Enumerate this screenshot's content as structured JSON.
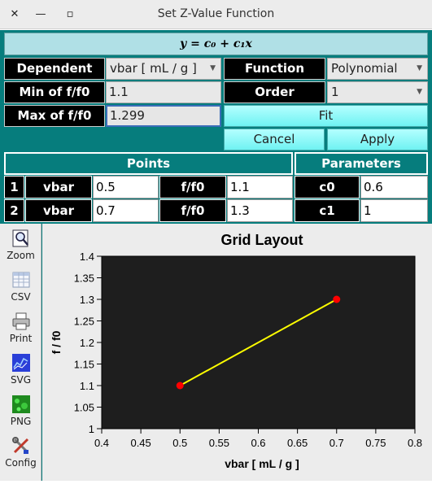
{
  "window": {
    "title": "Set Z-Value Function",
    "close_glyph": "✕",
    "min_glyph": "—",
    "max_glyph": "▫"
  },
  "banner": {
    "equation": "y = c₀ + c₁x"
  },
  "form": {
    "dependent_label": "Dependent",
    "dependent_value": "vbar [ mL / g ]",
    "function_label": "Function",
    "function_value": "Polynomial",
    "min_label": "Min of f/f0",
    "min_value": "1.1",
    "order_label": "Order",
    "order_value": "1",
    "max_label": "Max of f/f0",
    "max_value": "1.299",
    "fit_label": "Fit",
    "cancel_label": "Cancel",
    "apply_label": "Apply"
  },
  "points": {
    "header": "Points",
    "rows": [
      {
        "index": "1",
        "xname": "vbar",
        "xval": "0.5",
        "yname": "f/f0",
        "yval": "1.1"
      },
      {
        "index": "2",
        "xname": "vbar",
        "xval": "0.7",
        "yname": "f/f0",
        "yval": "1.3"
      }
    ]
  },
  "parameters": {
    "header": "Parameters",
    "rows": [
      {
        "name": "c0",
        "value": "0.6"
      },
      {
        "name": "c1",
        "value": "1"
      }
    ]
  },
  "toolbar": [
    {
      "label": "Zoom",
      "icon": "zoom-icon"
    },
    {
      "label": "CSV",
      "icon": "csv-icon"
    },
    {
      "label": "Print",
      "icon": "print-icon"
    },
    {
      "label": "SVG",
      "icon": "svg-icon"
    },
    {
      "label": "PNG",
      "icon": "png-icon"
    },
    {
      "label": "Config",
      "icon": "config-icon"
    }
  ],
  "colors": {
    "teal": "#067d7d",
    "plot_bg": "#1e1e1e",
    "line": "#ffff00",
    "marker": "#ff0000"
  },
  "chart_data": {
    "type": "line",
    "title": "Grid Layout",
    "xlabel": "vbar [ mL / g ]",
    "ylabel": "f / f0",
    "xlim": [
      0.4,
      0.8
    ],
    "ylim": [
      1.0,
      1.4
    ],
    "xticks": [
      "0.4",
      "0.45",
      "0.5",
      "0.55",
      "0.6",
      "0.65",
      "0.7",
      "0.75",
      "0.8"
    ],
    "yticks": [
      "1",
      "1.05",
      "1.1",
      "1.15",
      "1.2",
      "1.25",
      "1.3",
      "1.35",
      "1.4"
    ],
    "grid": false,
    "series": [
      {
        "x": [
          0.5,
          0.7
        ],
        "y": [
          1.1,
          1.3
        ]
      }
    ]
  }
}
